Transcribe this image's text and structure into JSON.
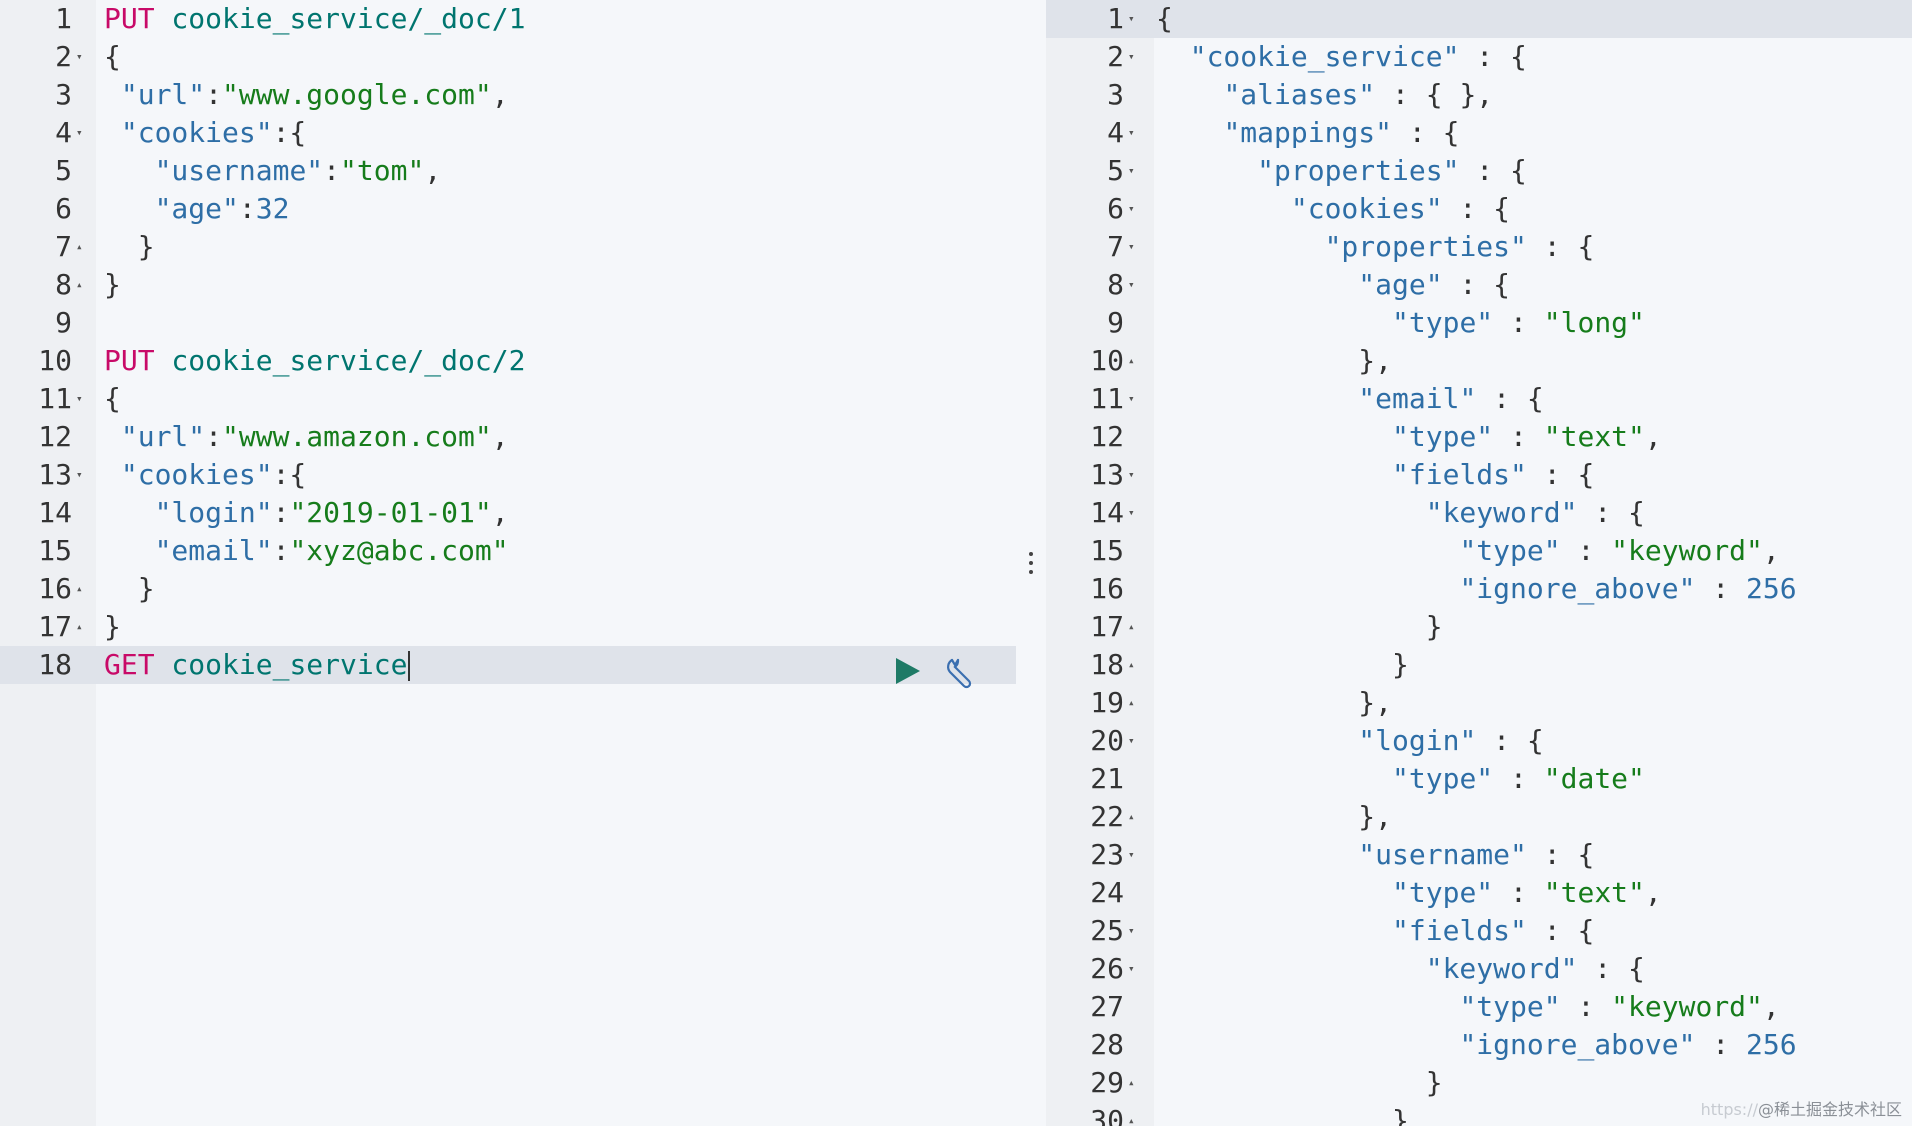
{
  "left_editor": {
    "lines": [
      {
        "num": "1",
        "fold": "",
        "tokens": [
          {
            "c": "m",
            "t": "PUT"
          },
          {
            "c": "u",
            "t": " cookie_service/_doc/1"
          }
        ]
      },
      {
        "num": "2",
        "fold": "▾",
        "tokens": [
          {
            "c": "p",
            "t": "{"
          }
        ]
      },
      {
        "num": "3",
        "fold": "",
        "tokens": [
          {
            "c": "p",
            "t": " "
          },
          {
            "c": "k",
            "t": "\"url\""
          },
          {
            "c": "p",
            "t": ":"
          },
          {
            "c": "s",
            "t": "\"www.google.com\""
          },
          {
            "c": "p",
            "t": ","
          }
        ]
      },
      {
        "num": "4",
        "fold": "▾",
        "tokens": [
          {
            "c": "p",
            "t": " "
          },
          {
            "c": "k",
            "t": "\"cookies\""
          },
          {
            "c": "p",
            "t": ":{"
          }
        ]
      },
      {
        "num": "5",
        "fold": "",
        "tokens": [
          {
            "c": "p",
            "t": "   "
          },
          {
            "c": "k",
            "t": "\"username\""
          },
          {
            "c": "p",
            "t": ":"
          },
          {
            "c": "s",
            "t": "\"tom\""
          },
          {
            "c": "p",
            "t": ","
          }
        ]
      },
      {
        "num": "6",
        "fold": "",
        "tokens": [
          {
            "c": "p",
            "t": "   "
          },
          {
            "c": "k",
            "t": "\"age\""
          },
          {
            "c": "p",
            "t": ":"
          },
          {
            "c": "n",
            "t": "32"
          }
        ]
      },
      {
        "num": "7",
        "fold": "▴",
        "tokens": [
          {
            "c": "p",
            "t": "  }"
          }
        ]
      },
      {
        "num": "8",
        "fold": "▴",
        "tokens": [
          {
            "c": "p",
            "t": "}"
          }
        ]
      },
      {
        "num": "9",
        "fold": "",
        "tokens": []
      },
      {
        "num": "10",
        "fold": "",
        "tokens": [
          {
            "c": "m",
            "t": "PUT"
          },
          {
            "c": "u",
            "t": " cookie_service/_doc/2"
          }
        ]
      },
      {
        "num": "11",
        "fold": "▾",
        "tokens": [
          {
            "c": "p",
            "t": "{"
          }
        ]
      },
      {
        "num": "12",
        "fold": "",
        "tokens": [
          {
            "c": "p",
            "t": " "
          },
          {
            "c": "k",
            "t": "\"url\""
          },
          {
            "c": "p",
            "t": ":"
          },
          {
            "c": "s",
            "t": "\"www.amazon.com\""
          },
          {
            "c": "p",
            "t": ","
          }
        ]
      },
      {
        "num": "13",
        "fold": "▾",
        "tokens": [
          {
            "c": "p",
            "t": " "
          },
          {
            "c": "k",
            "t": "\"cookies\""
          },
          {
            "c": "p",
            "t": ":{"
          }
        ]
      },
      {
        "num": "14",
        "fold": "",
        "tokens": [
          {
            "c": "p",
            "t": "   "
          },
          {
            "c": "k",
            "t": "\"login\""
          },
          {
            "c": "p",
            "t": ":"
          },
          {
            "c": "s",
            "t": "\"2019-01-01\""
          },
          {
            "c": "p",
            "t": ","
          }
        ]
      },
      {
        "num": "15",
        "fold": "",
        "tokens": [
          {
            "c": "p",
            "t": "   "
          },
          {
            "c": "k",
            "t": "\"email\""
          },
          {
            "c": "p",
            "t": ":"
          },
          {
            "c": "s",
            "t": "\"xyz@abc.com\""
          }
        ]
      },
      {
        "num": "16",
        "fold": "▴",
        "tokens": [
          {
            "c": "p",
            "t": "  }"
          }
        ]
      },
      {
        "num": "17",
        "fold": "▴",
        "tokens": [
          {
            "c": "p",
            "t": "}"
          }
        ]
      },
      {
        "num": "18",
        "fold": "",
        "tokens": [
          {
            "c": "m",
            "t": "GET"
          },
          {
            "c": "u",
            "t": " cookie_service"
          }
        ]
      }
    ],
    "active_line": "18"
  },
  "right_editor": {
    "lines": [
      {
        "num": "1",
        "fold": "▾",
        "text": "{"
      },
      {
        "num": "2",
        "fold": "▾",
        "text": "  \"cookie_service\" : {"
      },
      {
        "num": "3",
        "fold": "",
        "text": "    \"aliases\" : { },"
      },
      {
        "num": "4",
        "fold": "▾",
        "text": "    \"mappings\" : {"
      },
      {
        "num": "5",
        "fold": "▾",
        "text": "      \"properties\" : {"
      },
      {
        "num": "6",
        "fold": "▾",
        "text": "        \"cookies\" : {"
      },
      {
        "num": "7",
        "fold": "▾",
        "text": "          \"properties\" : {"
      },
      {
        "num": "8",
        "fold": "▾",
        "text": "            \"age\" : {"
      },
      {
        "num": "9",
        "fold": "",
        "text": "              \"type\" : \"long\""
      },
      {
        "num": "10",
        "fold": "▴",
        "text": "            },"
      },
      {
        "num": "11",
        "fold": "▾",
        "text": "            \"email\" : {"
      },
      {
        "num": "12",
        "fold": "",
        "text": "              \"type\" : \"text\","
      },
      {
        "num": "13",
        "fold": "▾",
        "text": "              \"fields\" : {"
      },
      {
        "num": "14",
        "fold": "▾",
        "text": "                \"keyword\" : {"
      },
      {
        "num": "15",
        "fold": "",
        "text": "                  \"type\" : \"keyword\","
      },
      {
        "num": "16",
        "fold": "",
        "text": "                  \"ignore_above\" : 256"
      },
      {
        "num": "17",
        "fold": "▴",
        "text": "                }"
      },
      {
        "num": "18",
        "fold": "▴",
        "text": "              }"
      },
      {
        "num": "19",
        "fold": "▴",
        "text": "            },"
      },
      {
        "num": "20",
        "fold": "▾",
        "text": "            \"login\" : {"
      },
      {
        "num": "21",
        "fold": "",
        "text": "              \"type\" : \"date\""
      },
      {
        "num": "22",
        "fold": "▴",
        "text": "            },"
      },
      {
        "num": "23",
        "fold": "▾",
        "text": "            \"username\" : {"
      },
      {
        "num": "24",
        "fold": "",
        "text": "              \"type\" : \"text\","
      },
      {
        "num": "25",
        "fold": "▾",
        "text": "              \"fields\" : {"
      },
      {
        "num": "26",
        "fold": "▾",
        "text": "                \"keyword\" : {"
      },
      {
        "num": "27",
        "fold": "",
        "text": "                  \"type\" : \"keyword\","
      },
      {
        "num": "28",
        "fold": "",
        "text": "                  \"ignore_above\" : 256"
      },
      {
        "num": "29",
        "fold": "▴",
        "text": "                }"
      },
      {
        "num": "30",
        "fold": "▴",
        "text": "              }"
      }
    ]
  },
  "toolbar": {
    "run_icon": "play-icon",
    "settings_icon": "wrench-icon"
  },
  "watermark": {
    "text_faint": "https://",
    "text": "@稀土掘金技术社区"
  },
  "colors": {
    "method": "#c80a68",
    "url": "#00756f",
    "key": "#2e6ea6",
    "string": "#167c1b",
    "number": "#2e6ea6",
    "run_button": "#1e7a66"
  }
}
